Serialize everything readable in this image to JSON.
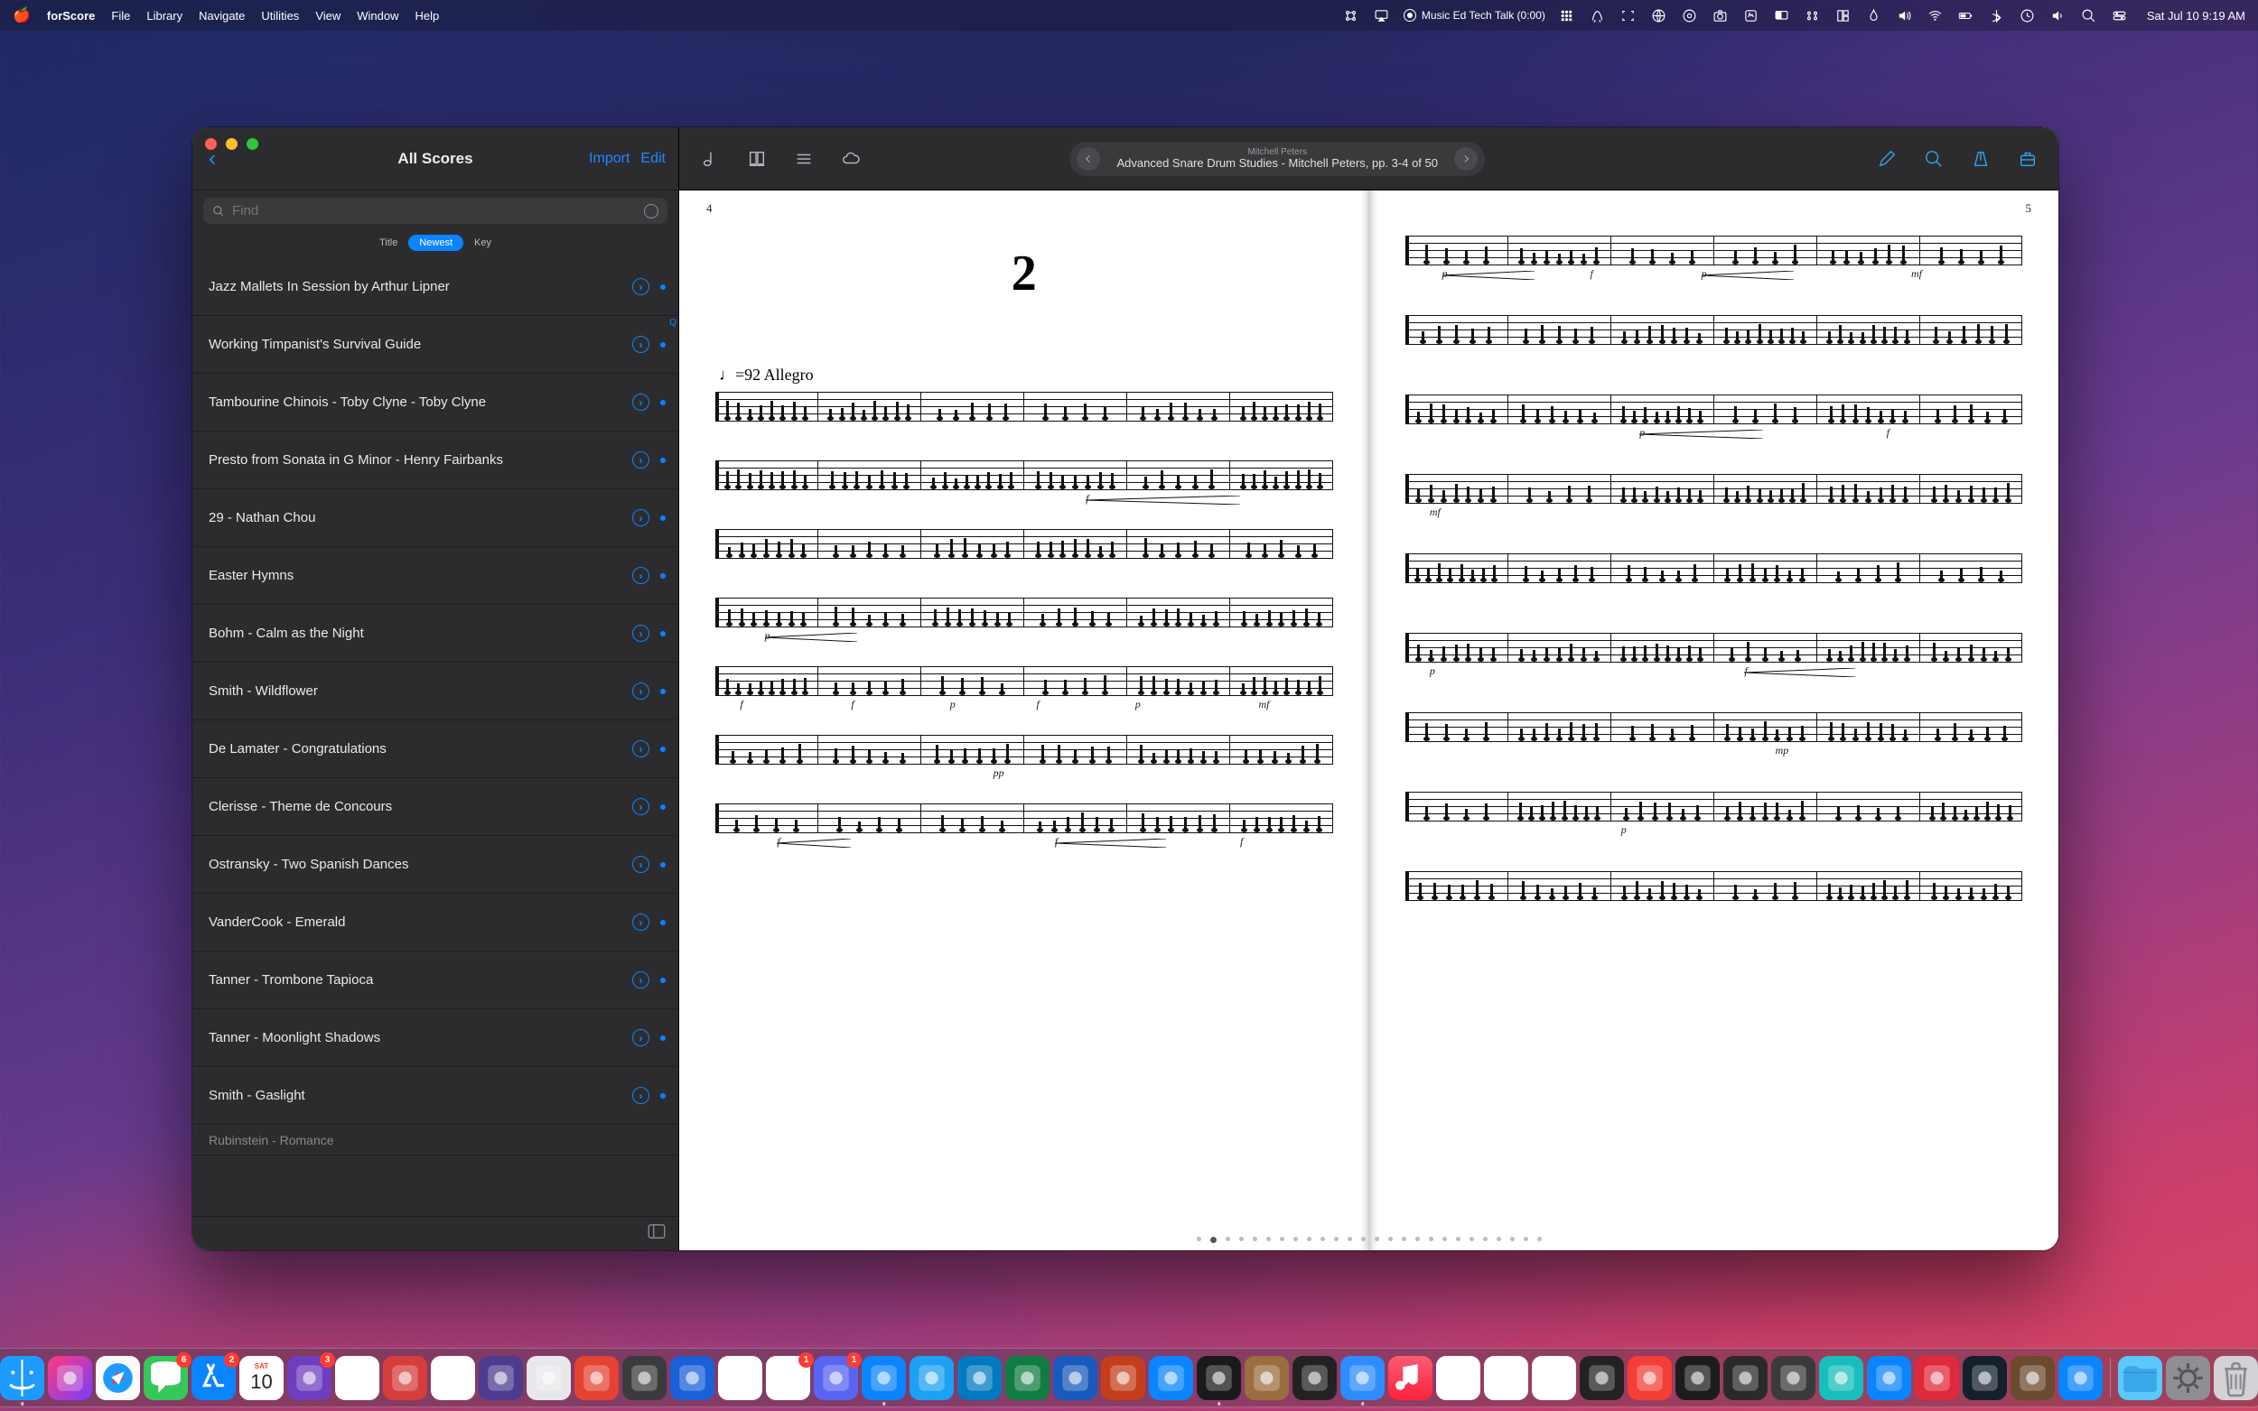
{
  "menubar": {
    "app": "forScore",
    "menus": [
      "File",
      "Library",
      "Navigate",
      "Utilities",
      "View",
      "Window",
      "Help"
    ],
    "podcast": "Music Ed Tech Talk (0:00)",
    "clock": "Sat Jul 10  9:19 AM"
  },
  "sidebar": {
    "title": "All Scores",
    "back_glyph": "‹",
    "import": "Import",
    "edit": "Edit",
    "search_placeholder": "Find",
    "sort": {
      "options": [
        "Title",
        "Newest",
        "Key"
      ],
      "active": "Newest"
    },
    "items": [
      "Jazz Mallets In Session by Arthur Lipner",
      "Working Timpanist's Survival Guide",
      "Tambourine Chinois - Toby Clyne - Toby Clyne",
      "Presto from Sonata in G Minor - Henry Fairbanks",
      "29 - Nathan Chou",
      "Easter Hymns",
      "Bohm - Calm as the Night",
      "Smith - Wildflower",
      "De Lamater - Congratulations",
      "Clerisse - Theme de Concours",
      "Ostransky - Two Spanish Dances",
      "VanderCook - Emerald",
      "Tanner - Trombone Tapioca",
      "Tanner - Moonlight Shadows",
      "Smith - Gaslight"
    ],
    "partial_item": "Rubinstein - Romance",
    "chev_glyph": "›"
  },
  "doc": {
    "composer": "Mitchell Peters",
    "title": "Advanced Snare Drum Studies - Mitchell Peters, pp. 3-4 of 50",
    "left_page_num": "4",
    "right_page_num": "5",
    "piece_number": "2",
    "tempo_marking": "♩=92  Allegro",
    "dynamics": {
      "p": "p",
      "f": "f",
      "mf": "mf",
      "pp": "pp",
      "mp": "mp"
    }
  },
  "dock": {
    "icons": [
      {
        "name": "finder",
        "bg": "#1e9bff",
        "running": true
      },
      {
        "name": "shortcuts",
        "bg": "linear-gradient(135deg,#ff3b7b,#7a3bff)"
      },
      {
        "name": "safari",
        "bg": "#fafafa"
      },
      {
        "name": "messages",
        "bg": "#34c759",
        "badge": "6"
      },
      {
        "name": "appstore",
        "bg": "#0a84ff",
        "badge": "2"
      },
      {
        "name": "calendar",
        "bg": "#fff",
        "text": "10",
        "sub": "SAT"
      },
      {
        "name": "omnifocus",
        "bg": "#6e3ebf",
        "badge": "3"
      },
      {
        "name": "things",
        "bg": "#fff"
      },
      {
        "name": "drafts",
        "bg": "#d63d3d"
      },
      {
        "name": "notes",
        "bg": "#fff"
      },
      {
        "name": "obsidian",
        "bg": "#4c3b8f"
      },
      {
        "name": "readdle",
        "bg": "#e8e8ec"
      },
      {
        "name": "todoist",
        "bg": "#e44332"
      },
      {
        "name": "app1",
        "bg": "#3b3b3d"
      },
      {
        "name": "1password",
        "bg": "#1a60d8"
      },
      {
        "name": "notability",
        "bg": "#fff"
      },
      {
        "name": "slack",
        "bg": "#fff",
        "badge": "1"
      },
      {
        "name": "discord",
        "bg": "#5865f2",
        "badge": "1"
      },
      {
        "name": "spark",
        "bg": "#0a84ff",
        "running": true
      },
      {
        "name": "tweetbot",
        "bg": "#1da1f2"
      },
      {
        "name": "trello",
        "bg": "#0079bf"
      },
      {
        "name": "excel",
        "bg": "#107c41"
      },
      {
        "name": "word",
        "bg": "#185abd"
      },
      {
        "name": "powerpoint",
        "bg": "#c43e1c"
      },
      {
        "name": "keynote",
        "bg": "#0a84ff"
      },
      {
        "name": "forScore",
        "bg": "#1a1a1c",
        "running": true
      },
      {
        "name": "hazel",
        "bg": "#9b6e3f"
      },
      {
        "name": "app2",
        "bg": "#222"
      },
      {
        "name": "zoom",
        "bg": "#2d8cff",
        "running": true
      },
      {
        "name": "music",
        "bg": "linear-gradient(#fb5c74,#fa233b)"
      },
      {
        "name": "youtube",
        "bg": "#fff"
      },
      {
        "name": "audacity",
        "bg": "#fff"
      },
      {
        "name": "screenflow",
        "bg": "#fff"
      },
      {
        "name": "editor",
        "bg": "#222"
      },
      {
        "name": "pocketcasts",
        "bg": "#f43e37"
      },
      {
        "name": "terminal",
        "bg": "#1c1c1e"
      },
      {
        "name": "hindenburg",
        "bg": "#2a2a2c"
      },
      {
        "name": "finalcut",
        "bg": "#3a3a3c"
      },
      {
        "name": "affinity",
        "bg": "#17bebb"
      },
      {
        "name": "appblue",
        "bg": "#0a84ff"
      },
      {
        "name": "appred",
        "bg": "#e0293a"
      },
      {
        "name": "steam",
        "bg": "#14202c"
      },
      {
        "name": "guitar",
        "bg": "#6b4a2f"
      },
      {
        "name": "cleanshot",
        "bg": "#0a84ff"
      }
    ],
    "rightIcons": [
      {
        "name": "folder",
        "bg": "#5ac8fa"
      },
      {
        "name": "settings",
        "bg": "#8e8e93"
      },
      {
        "name": "trash",
        "bg": "#d1d1d6"
      }
    ]
  }
}
